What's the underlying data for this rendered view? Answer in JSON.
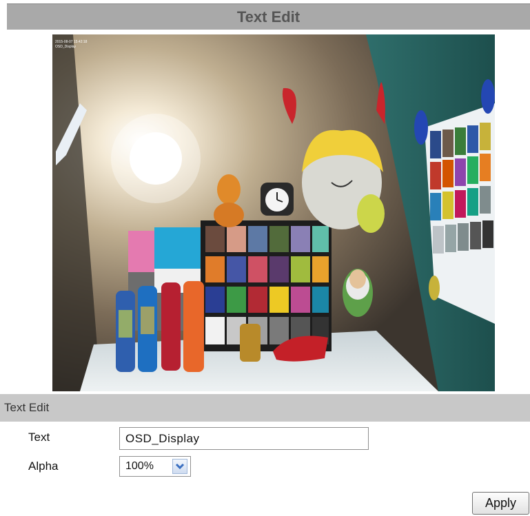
{
  "header": {
    "title": "Text Edit"
  },
  "camera": {
    "overlay_line1": "2015-08-07 15:42:18",
    "overlay_line2": "OSD_Display"
  },
  "section": {
    "title": "Text Edit"
  },
  "form": {
    "text_label": "Text",
    "text_value": "OSD_Display",
    "alpha_label": "Alpha",
    "alpha_value": "100%",
    "alpha_arrow_icon": "chevron-down-icon"
  },
  "actions": {
    "apply_label": "Apply"
  },
  "colors": {
    "title_bar": "#a9a9a9",
    "section_bar": "#c8c8c8",
    "dropdown_arrow": "#3a6fc0"
  }
}
